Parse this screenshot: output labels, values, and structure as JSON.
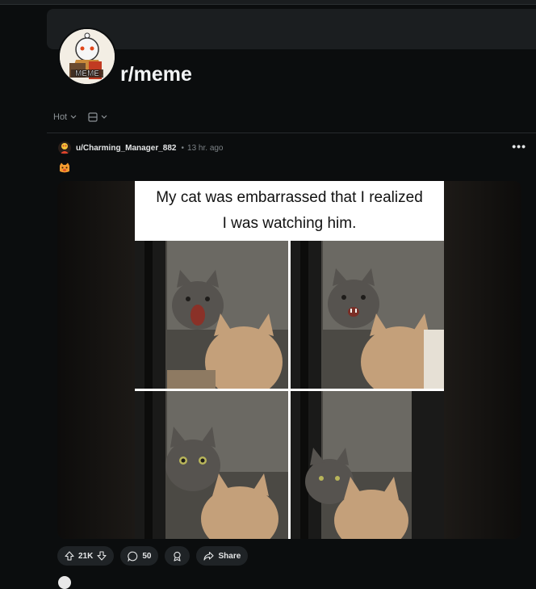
{
  "subreddit": {
    "name": "r/meme",
    "avatar_icon": "meme-snoo-avatar",
    "avatar_text": "MEME"
  },
  "sort": {
    "label": "Hot",
    "view_icon": "card-view-icon"
  },
  "post": {
    "author": "u/Charming_Manager_882",
    "separator": "•",
    "time": "13 hr. ago",
    "more_label": "•••",
    "flair_icon": "cat-emoji-icon",
    "image_caption_line1": "My cat was embarrassed that I realized",
    "image_caption_line2": "I was watching him.",
    "votes": "21K",
    "comments": "50",
    "share_label": "Share"
  },
  "colors": {
    "background": "#0b0d0e",
    "pill_bg": "#1f2326",
    "text": "#d7dadc"
  }
}
